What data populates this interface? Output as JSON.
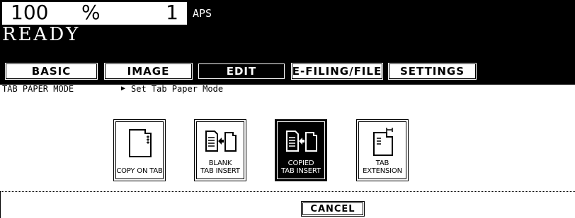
{
  "status": {
    "zoom_value": "100",
    "zoom_unit": "%",
    "copy_count": "1",
    "paper_mode": "APS",
    "message": "READY"
  },
  "tabs": [
    {
      "label": "BASIC",
      "active": false
    },
    {
      "label": "IMAGE",
      "active": false
    },
    {
      "label": "EDIT",
      "active": true
    },
    {
      "label": "E-FILING/FILE",
      "active": false
    },
    {
      "label": "SETTINGS",
      "active": false
    }
  ],
  "breadcrumb": {
    "mode": "TAB PAPER MODE",
    "action": "Set Tab Paper Mode"
  },
  "functions": [
    {
      "label_line1": "COPY ON TAB",
      "label_line2": "",
      "icon": "copy-on-tab-icon",
      "selected": false
    },
    {
      "label_line1": "BLANK",
      "label_line2": "TAB INSERT",
      "icon": "blank-tab-insert-icon",
      "selected": false
    },
    {
      "label_line1": "COPIED",
      "label_line2": "TAB INSERT",
      "icon": "copied-tab-insert-icon",
      "selected": true
    },
    {
      "label_line1": "TAB",
      "label_line2": "EXTENSION",
      "icon": "tab-extension-icon",
      "selected": false
    }
  ],
  "cancel_label": "CANCEL",
  "colors": {
    "background": "#ffffff",
    "panel": "#000000",
    "selected": "#000000"
  }
}
